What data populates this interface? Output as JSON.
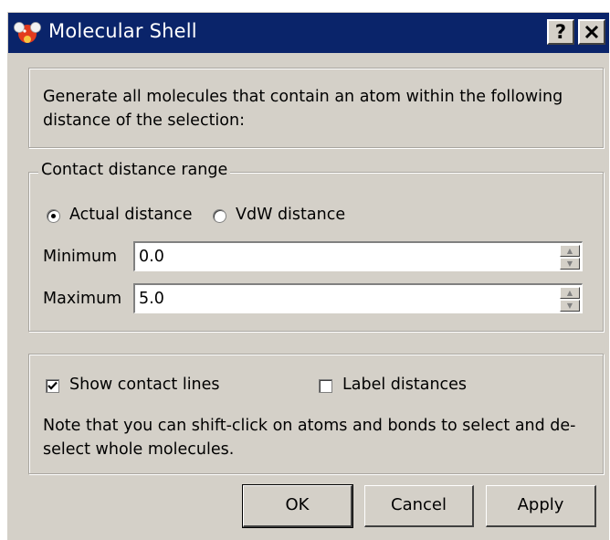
{
  "window": {
    "title": "Molecular Shell",
    "help_label": "?",
    "close_label": "✕"
  },
  "description": {
    "text": "Generate all molecules that contain an atom within the following distance of the selection:"
  },
  "contact": {
    "group_label": "Contact distance range",
    "actual_label": "Actual distance",
    "vdw_label": "VdW distance",
    "selected_mode": "Actual distance",
    "minimum_label": "Minimum",
    "minimum_value": "0.0",
    "maximum_label": "Maximum",
    "maximum_value": "5.0"
  },
  "options": {
    "show_lines_label": "Show contact lines",
    "show_lines_checked": true,
    "label_distances_label": "Label distances",
    "label_distances_checked": false,
    "note": "Note that you can shift-click on atoms and bonds to select and de-select whole molecules."
  },
  "buttons": {
    "ok": "OK",
    "cancel": "Cancel",
    "apply": "Apply"
  },
  "colors": {
    "titlebar": "#0a246a",
    "face": "#d4d0c8"
  }
}
